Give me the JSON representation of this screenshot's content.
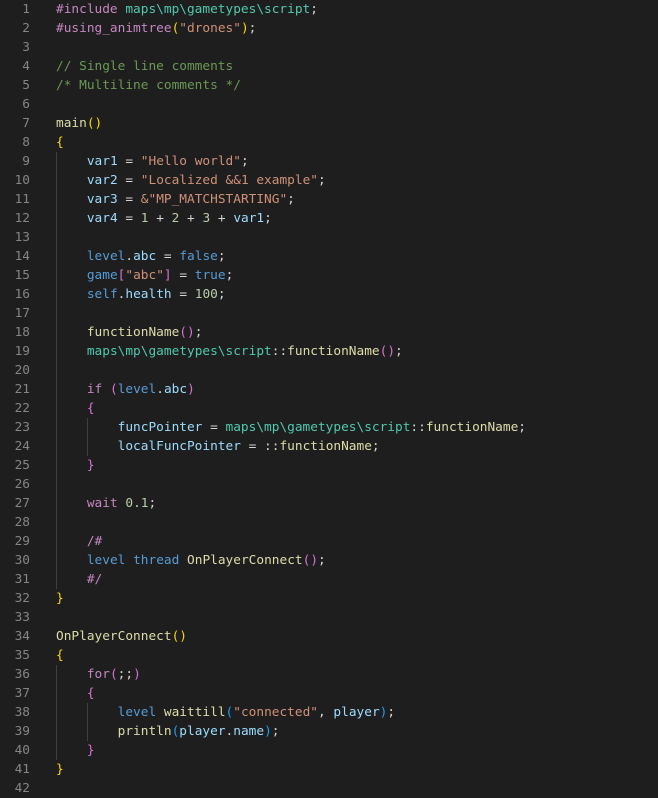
{
  "colors": {
    "background": "#1e1e1e",
    "line_number": "#858585",
    "default": "#d4d4d4",
    "keyword_blue": "#569cd6",
    "control_purple": "#c586c0",
    "string": "#ce9178",
    "comment": "#6a9955",
    "function": "#dcdcaa",
    "variable": "#9cdcfe",
    "number": "#b5cea8",
    "namespace": "#4ec9b0",
    "bracket_gold": "#ffd700",
    "bracket_pink": "#da70d6",
    "bracket_blue": "#179fff"
  },
  "editor": {
    "lines": [
      {
        "number": "1",
        "tokens": [
          {
            "t": "#include ",
            "c": "control_purple"
          },
          {
            "t": "maps\\mp\\gametypes\\script",
            "c": "namespace"
          },
          {
            "t": ";",
            "c": "default"
          }
        ]
      },
      {
        "number": "2",
        "tokens": [
          {
            "t": "#using_animtree",
            "c": "control_purple"
          },
          {
            "t": "(",
            "c": "bracket_gold"
          },
          {
            "t": "\"drones\"",
            "c": "string"
          },
          {
            "t": ")",
            "c": "bracket_gold"
          },
          {
            "t": ";",
            "c": "default"
          }
        ]
      },
      {
        "number": "3",
        "tokens": []
      },
      {
        "number": "4",
        "tokens": [
          {
            "t": "// Single line comments",
            "c": "comment"
          }
        ]
      },
      {
        "number": "5",
        "tokens": [
          {
            "t": "/* Multiline comments */",
            "c": "comment"
          }
        ]
      },
      {
        "number": "6",
        "tokens": []
      },
      {
        "number": "7",
        "tokens": [
          {
            "t": "main",
            "c": "function"
          },
          {
            "t": "()",
            "c": "bracket_gold"
          }
        ]
      },
      {
        "number": "8",
        "tokens": [
          {
            "t": "{",
            "c": "bracket_gold"
          }
        ]
      },
      {
        "number": "9",
        "tokens": [
          {
            "t": "    ",
            "c": "default"
          },
          {
            "t": "var1",
            "c": "variable"
          },
          {
            "t": " = ",
            "c": "default"
          },
          {
            "t": "\"Hello world\"",
            "c": "string"
          },
          {
            "t": ";",
            "c": "default"
          }
        ]
      },
      {
        "number": "10",
        "tokens": [
          {
            "t": "    ",
            "c": "default"
          },
          {
            "t": "var2",
            "c": "variable"
          },
          {
            "t": " = ",
            "c": "default"
          },
          {
            "t": "\"Localized &&1 example\"",
            "c": "string"
          },
          {
            "t": ";",
            "c": "default"
          }
        ]
      },
      {
        "number": "11",
        "tokens": [
          {
            "t": "    ",
            "c": "default"
          },
          {
            "t": "var3",
            "c": "variable"
          },
          {
            "t": " = ",
            "c": "default"
          },
          {
            "t": "&\"MP_MATCHSTARTING\"",
            "c": "string"
          },
          {
            "t": ";",
            "c": "default"
          }
        ]
      },
      {
        "number": "12",
        "tokens": [
          {
            "t": "    ",
            "c": "default"
          },
          {
            "t": "var4",
            "c": "variable"
          },
          {
            "t": " = ",
            "c": "default"
          },
          {
            "t": "1",
            "c": "number"
          },
          {
            "t": " + ",
            "c": "default"
          },
          {
            "t": "2",
            "c": "number"
          },
          {
            "t": " + ",
            "c": "default"
          },
          {
            "t": "3",
            "c": "number"
          },
          {
            "t": " + ",
            "c": "default"
          },
          {
            "t": "var1",
            "c": "variable"
          },
          {
            "t": ";",
            "c": "default"
          }
        ]
      },
      {
        "number": "13",
        "tokens": []
      },
      {
        "number": "14",
        "tokens": [
          {
            "t": "    ",
            "c": "default"
          },
          {
            "t": "level",
            "c": "keyword_blue"
          },
          {
            "t": ".",
            "c": "default"
          },
          {
            "t": "abc",
            "c": "variable"
          },
          {
            "t": " = ",
            "c": "default"
          },
          {
            "t": "false",
            "c": "keyword_blue"
          },
          {
            "t": ";",
            "c": "default"
          }
        ]
      },
      {
        "number": "15",
        "tokens": [
          {
            "t": "    ",
            "c": "default"
          },
          {
            "t": "game",
            "c": "keyword_blue"
          },
          {
            "t": "[",
            "c": "bracket_pink"
          },
          {
            "t": "\"abc\"",
            "c": "string"
          },
          {
            "t": "]",
            "c": "bracket_pink"
          },
          {
            "t": " = ",
            "c": "default"
          },
          {
            "t": "true",
            "c": "keyword_blue"
          },
          {
            "t": ";",
            "c": "default"
          }
        ]
      },
      {
        "number": "16",
        "tokens": [
          {
            "t": "    ",
            "c": "default"
          },
          {
            "t": "self",
            "c": "keyword_blue"
          },
          {
            "t": ".",
            "c": "default"
          },
          {
            "t": "health",
            "c": "variable"
          },
          {
            "t": " = ",
            "c": "default"
          },
          {
            "t": "100",
            "c": "number"
          },
          {
            "t": ";",
            "c": "default"
          }
        ]
      },
      {
        "number": "17",
        "tokens": []
      },
      {
        "number": "18",
        "tokens": [
          {
            "t": "    ",
            "c": "default"
          },
          {
            "t": "functionName",
            "c": "function"
          },
          {
            "t": "()",
            "c": "bracket_pink"
          },
          {
            "t": ";",
            "c": "default"
          }
        ]
      },
      {
        "number": "19",
        "tokens": [
          {
            "t": "    ",
            "c": "default"
          },
          {
            "t": "maps\\mp\\gametypes\\script",
            "c": "namespace"
          },
          {
            "t": "::",
            "c": "default"
          },
          {
            "t": "functionName",
            "c": "function"
          },
          {
            "t": "()",
            "c": "bracket_pink"
          },
          {
            "t": ";",
            "c": "default"
          }
        ]
      },
      {
        "number": "20",
        "tokens": []
      },
      {
        "number": "21",
        "tokens": [
          {
            "t": "    ",
            "c": "default"
          },
          {
            "t": "if",
            "c": "control_purple"
          },
          {
            "t": " ",
            "c": "default"
          },
          {
            "t": "(",
            "c": "bracket_pink"
          },
          {
            "t": "level",
            "c": "keyword_blue"
          },
          {
            "t": ".",
            "c": "default"
          },
          {
            "t": "abc",
            "c": "variable"
          },
          {
            "t": ")",
            "c": "bracket_pink"
          }
        ]
      },
      {
        "number": "22",
        "tokens": [
          {
            "t": "    ",
            "c": "default"
          },
          {
            "t": "{",
            "c": "bracket_pink"
          }
        ]
      },
      {
        "number": "23",
        "tokens": [
          {
            "t": "        ",
            "c": "default"
          },
          {
            "t": "funcPointer",
            "c": "variable"
          },
          {
            "t": " = ",
            "c": "default"
          },
          {
            "t": "maps\\mp\\gametypes\\script",
            "c": "namespace"
          },
          {
            "t": "::",
            "c": "default"
          },
          {
            "t": "functionName",
            "c": "function"
          },
          {
            "t": ";",
            "c": "default"
          }
        ]
      },
      {
        "number": "24",
        "tokens": [
          {
            "t": "        ",
            "c": "default"
          },
          {
            "t": "localFuncPointer",
            "c": "variable"
          },
          {
            "t": " = ",
            "c": "default"
          },
          {
            "t": "::",
            "c": "default"
          },
          {
            "t": "functionName",
            "c": "function"
          },
          {
            "t": ";",
            "c": "default"
          }
        ]
      },
      {
        "number": "25",
        "tokens": [
          {
            "t": "    ",
            "c": "default"
          },
          {
            "t": "}",
            "c": "bracket_pink"
          }
        ]
      },
      {
        "number": "26",
        "tokens": []
      },
      {
        "number": "27",
        "tokens": [
          {
            "t": "    ",
            "c": "default"
          },
          {
            "t": "wait",
            "c": "control_purple"
          },
          {
            "t": " ",
            "c": "default"
          },
          {
            "t": "0.1",
            "c": "number"
          },
          {
            "t": ";",
            "c": "default"
          }
        ]
      },
      {
        "number": "28",
        "tokens": []
      },
      {
        "number": "29",
        "tokens": [
          {
            "t": "    ",
            "c": "default"
          },
          {
            "t": "/#",
            "c": "control_purple"
          }
        ]
      },
      {
        "number": "30",
        "tokens": [
          {
            "t": "    ",
            "c": "default"
          },
          {
            "t": "level",
            "c": "keyword_blue"
          },
          {
            "t": " ",
            "c": "default"
          },
          {
            "t": "thread",
            "c": "keyword_blue"
          },
          {
            "t": " ",
            "c": "default"
          },
          {
            "t": "OnPlayerConnect",
            "c": "function"
          },
          {
            "t": "()",
            "c": "bracket_pink"
          },
          {
            "t": ";",
            "c": "default"
          }
        ]
      },
      {
        "number": "31",
        "tokens": [
          {
            "t": "    ",
            "c": "default"
          },
          {
            "t": "#/",
            "c": "control_purple"
          }
        ]
      },
      {
        "number": "32",
        "tokens": [
          {
            "t": "}",
            "c": "bracket_gold"
          }
        ]
      },
      {
        "number": "33",
        "tokens": []
      },
      {
        "number": "34",
        "tokens": [
          {
            "t": "OnPlayerConnect",
            "c": "function"
          },
          {
            "t": "()",
            "c": "bracket_gold"
          }
        ]
      },
      {
        "number": "35",
        "tokens": [
          {
            "t": "{",
            "c": "bracket_gold"
          }
        ]
      },
      {
        "number": "36",
        "tokens": [
          {
            "t": "    ",
            "c": "default"
          },
          {
            "t": "for",
            "c": "control_purple"
          },
          {
            "t": "(",
            "c": "bracket_pink"
          },
          {
            "t": ";;",
            "c": "default"
          },
          {
            "t": ")",
            "c": "bracket_pink"
          }
        ]
      },
      {
        "number": "37",
        "tokens": [
          {
            "t": "    ",
            "c": "default"
          },
          {
            "t": "{",
            "c": "bracket_pink"
          }
        ]
      },
      {
        "number": "38",
        "tokens": [
          {
            "t": "        ",
            "c": "default"
          },
          {
            "t": "level",
            "c": "keyword_blue"
          },
          {
            "t": " ",
            "c": "default"
          },
          {
            "t": "waittill",
            "c": "function"
          },
          {
            "t": "(",
            "c": "bracket_blue"
          },
          {
            "t": "\"connected\"",
            "c": "string"
          },
          {
            "t": ", ",
            "c": "default"
          },
          {
            "t": "player",
            "c": "variable"
          },
          {
            "t": ")",
            "c": "bracket_blue"
          },
          {
            "t": ";",
            "c": "default"
          }
        ]
      },
      {
        "number": "39",
        "tokens": [
          {
            "t": "        ",
            "c": "default"
          },
          {
            "t": "println",
            "c": "function"
          },
          {
            "t": "(",
            "c": "bracket_blue"
          },
          {
            "t": "player",
            "c": "variable"
          },
          {
            "t": ".",
            "c": "default"
          },
          {
            "t": "name",
            "c": "variable"
          },
          {
            "t": ")",
            "c": "bracket_blue"
          },
          {
            "t": ";",
            "c": "default"
          }
        ]
      },
      {
        "number": "40",
        "tokens": [
          {
            "t": "    ",
            "c": "default"
          },
          {
            "t": "}",
            "c": "bracket_pink"
          }
        ]
      },
      {
        "number": "41",
        "tokens": [
          {
            "t": "}",
            "c": "bracket_gold"
          }
        ]
      },
      {
        "number": "42",
        "tokens": []
      }
    ]
  }
}
